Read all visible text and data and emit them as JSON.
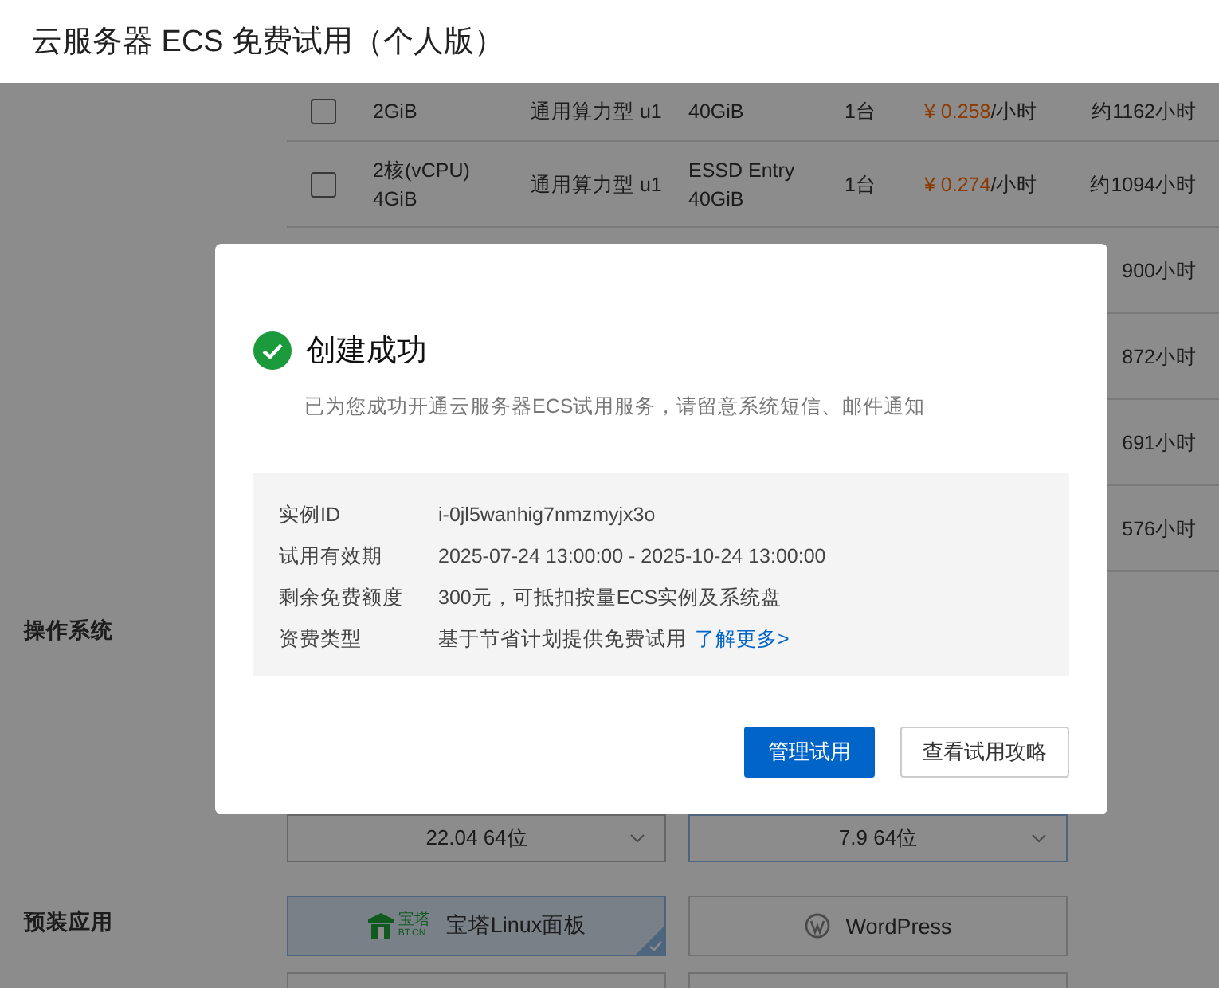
{
  "header": {
    "title": "云服务器 ECS 免费试用（个人版）"
  },
  "table": {
    "rows": [
      {
        "checked": false,
        "spec": "2GiB",
        "family": "通用算力型 u1",
        "disk": "40GiB",
        "quantity": "1台",
        "price": "¥ 0.258",
        "unit": "/小时",
        "hours": "约1162小时"
      },
      {
        "checked": false,
        "spec": "2核(vCPU)\n4GiB",
        "family": "通用算力型 u1",
        "disk": "ESSD Entry\n40GiB",
        "quantity": "1台",
        "price": "¥ 0.274",
        "unit": "/小时",
        "hours": "约1094小时"
      },
      {
        "hours": "900小时"
      },
      {
        "hours": "872小时"
      },
      {
        "hours": "691小时"
      },
      {
        "hours": "576小时"
      }
    ]
  },
  "os": {
    "label": "操作系统",
    "selects": [
      "22.04 64位",
      "7.9 64位"
    ]
  },
  "apps": {
    "label": "预装应用",
    "items": [
      {
        "kind": "baota",
        "name": "宝塔Linux面板",
        "logo_text": "宝塔",
        "logo_sub": "BT.CN",
        "selected": true
      },
      {
        "kind": "wordpress",
        "name": "WordPress",
        "selected": false
      }
    ]
  },
  "dialog": {
    "title": "创建成功",
    "message": "已为您成功开通云服务器ECS试用服务，请留意系统短信、邮件通知",
    "details": [
      {
        "label": "实例ID",
        "value": "i-0jl5wanhig7nmzmyjx3o"
      },
      {
        "label": "试用有效期",
        "value": "2025-07-24 13:00:00 - 2025-10-24 13:00:00"
      },
      {
        "label": "剩余免费额度",
        "value": "300元，可抵扣按量ECS实例及系统盘"
      },
      {
        "label": "资费类型",
        "value": "基于节省计划提供免费试用",
        "link": "了解更多>"
      }
    ],
    "buttons": [
      {
        "kind": "primary",
        "label": "管理试用"
      },
      {
        "kind": "secondary",
        "label": "查看试用攻略"
      }
    ]
  }
}
